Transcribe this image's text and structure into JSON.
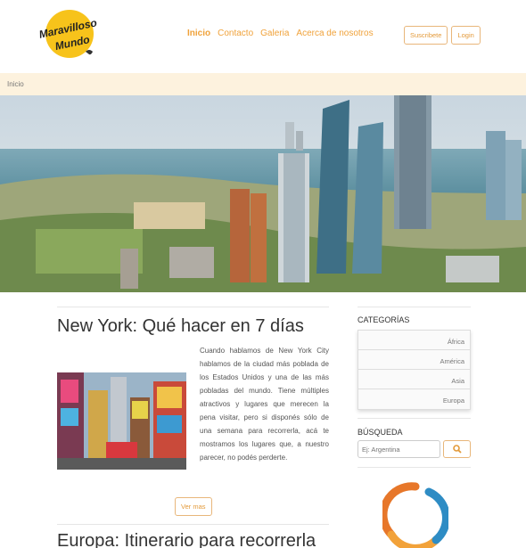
{
  "brand": {
    "line1": "Maravilloso",
    "line2": "Mundo",
    "colors": {
      "accent": "#f0a23a",
      "logo_yellow": "#f7c31b",
      "breadcrumb_bg": "#fdf2de"
    }
  },
  "nav": {
    "items": [
      "Inicio",
      "Contacto",
      "Galeria",
      "Acerca de nosotros"
    ],
    "active": "Inicio"
  },
  "auth": {
    "subscribe": "Suscribete",
    "login": "Login"
  },
  "breadcrumb": {
    "current": "Inicio"
  },
  "hero": {
    "image": "city-skyline-photo"
  },
  "posts": [
    {
      "title": "New York: Qué hacer en 7 días",
      "image": "times-square-photo",
      "excerpt": "Cuando hablamos de New York City hablamos de la ciudad más poblada de los Estados Unidos y una de las más pobladas del mundo. Tiene múltiples atractivos y lugares que merecen la pena visitar, pero si disponés sólo de una semana para recorrerla, acá te mostramos los lugares que, a nuestro parecer, no podés perderte.",
      "read_more": "Ver mas"
    },
    {
      "title": "Europa: Itinerario para recorrerla"
    }
  ],
  "sidebar": {
    "categories_title": "CATEGORÍAS",
    "categories": [
      "África",
      "América",
      "Asia",
      "Europa"
    ],
    "search_title": "BÚSQUEDA",
    "search_placeholder": "Ej: Argentina",
    "search_icon": "search-icon"
  }
}
